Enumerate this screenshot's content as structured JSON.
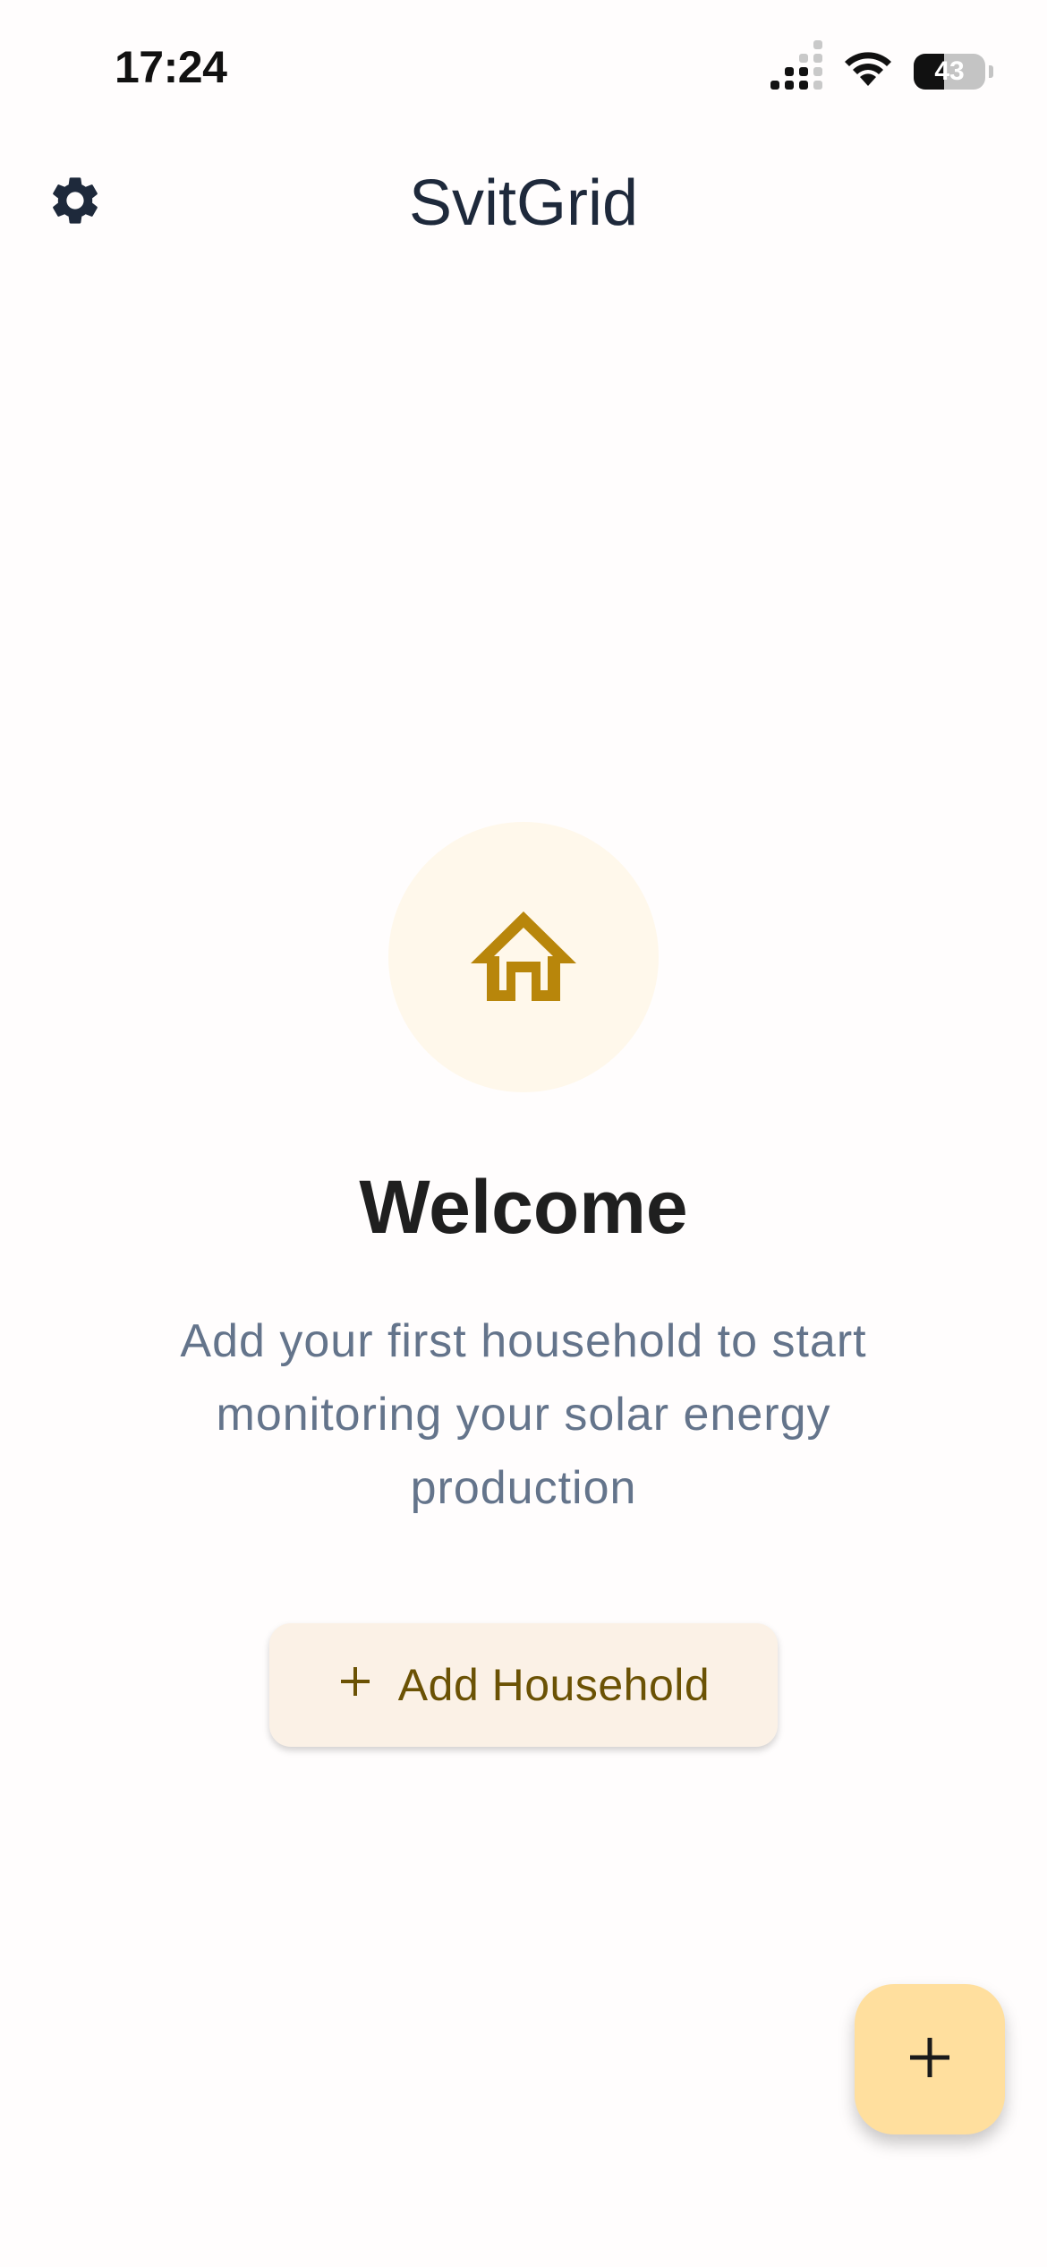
{
  "status_bar": {
    "time": "17:24",
    "battery_level": "43",
    "battery_fraction": 0.43,
    "signal_icon": "cellular-signal-icon",
    "wifi_icon": "wifi-icon"
  },
  "header": {
    "title": "SvitGrid",
    "settings_icon": "gear-icon"
  },
  "empty_state": {
    "icon": "home-icon",
    "title": "Welcome",
    "description": "Add your first household to start monitoring your solar energy production",
    "add_button_icon": "plus-icon",
    "add_button_label": "Add Household"
  },
  "fab": {
    "icon": "plus-icon"
  },
  "colors": {
    "accent": "#b8860b",
    "accent_text": "#6b5204",
    "fab_bg": "#ffdf9e",
    "icon_circle_bg": "#fff8eb",
    "header_text": "#1e293b",
    "body_text": "#64748b"
  }
}
